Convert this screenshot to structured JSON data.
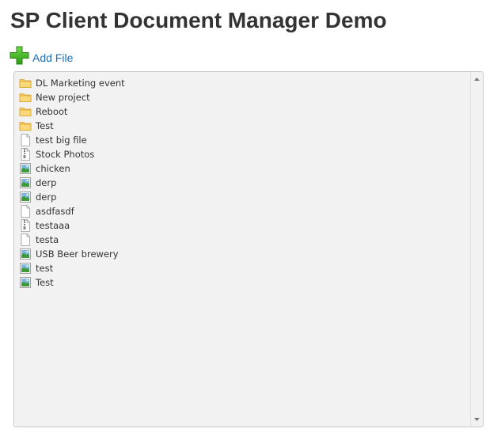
{
  "page": {
    "title": "SP Client Document Manager Demo"
  },
  "toolbar": {
    "add_file_label": "Add File",
    "add_icon": "plus-icon"
  },
  "colors": {
    "title": "#333333",
    "link": "#1a6fb5",
    "plus_green": "#3cb31c",
    "folder": "#f6c860",
    "panel_bg": "#f2f2f2"
  },
  "files": [
    {
      "name": "DL Marketing event",
      "type": "folder"
    },
    {
      "name": "New project",
      "type": "folder"
    },
    {
      "name": "Reboot",
      "type": "folder"
    },
    {
      "name": "Test",
      "type": "folder"
    },
    {
      "name": "test big file",
      "type": "file"
    },
    {
      "name": "Stock Photos",
      "type": "zip"
    },
    {
      "name": "chicken",
      "type": "image"
    },
    {
      "name": "derp",
      "type": "image"
    },
    {
      "name": "derp",
      "type": "image"
    },
    {
      "name": "asdfasdf",
      "type": "file"
    },
    {
      "name": "testaaa",
      "type": "zip"
    },
    {
      "name": "testa",
      "type": "file"
    },
    {
      "name": "USB Beer brewery",
      "type": "image"
    },
    {
      "name": "test",
      "type": "image"
    },
    {
      "name": "Test",
      "type": "image"
    }
  ]
}
